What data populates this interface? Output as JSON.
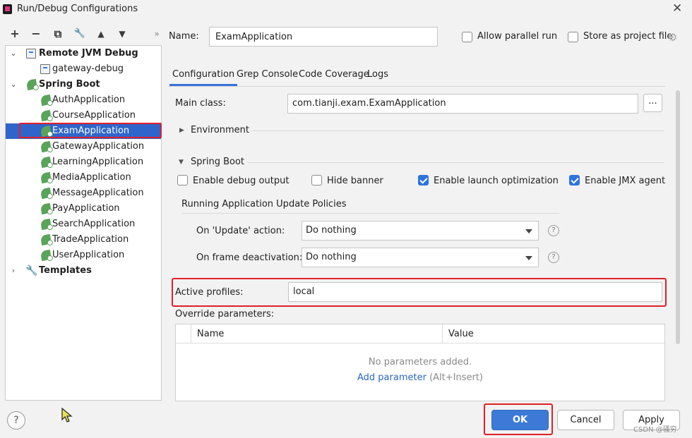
{
  "window": {
    "title": "Run/Debug Configurations"
  },
  "toolbar": {
    "icons": [
      "add-icon",
      "remove-icon",
      "copy-icon",
      "wrench-icon",
      "move-up-icon",
      "move-down-icon",
      "more-icon"
    ],
    "glyphs": {
      "add": "+",
      "remove": "−",
      "copy": "⧉",
      "wrench": "🔧",
      "up": "▲",
      "down": "▼",
      "more": "»"
    }
  },
  "tree": {
    "groups": [
      {
        "label": "Remote JVM Debug",
        "expanded": true,
        "children": [
          "gateway-debug"
        ]
      },
      {
        "label": "Spring Boot",
        "expanded": true,
        "children": [
          "AuthApplication",
          "CourseApplication",
          "ExamApplication",
          "GatewayApplication",
          "LearningApplication",
          "MediaApplication",
          "MessageApplication",
          "PayApplication",
          "SearchApplication",
          "TradeApplication",
          "UserApplication"
        ]
      },
      {
        "label": "Templates",
        "expanded": false,
        "children": []
      }
    ],
    "selected": "ExamApplication"
  },
  "header": {
    "name_label": "Name:",
    "name_value": "ExamApplication",
    "allow_parallel_label": "Allow parallel run",
    "allow_parallel_checked": false,
    "store_project_label": "Store as project file",
    "store_project_checked": false
  },
  "tabs": [
    "Configuration",
    "Grep Console",
    "Code Coverage",
    "Logs"
  ],
  "active_tab": "Configuration",
  "config": {
    "main_class_label": "Main class:",
    "main_class_value": "com.tianji.exam.ExamApplication",
    "browse_label": "...",
    "environment_label": "Environment",
    "spring_boot_label": "Spring Boot",
    "options": [
      {
        "label": "Enable debug output",
        "checked": false
      },
      {
        "label": "Hide banner",
        "checked": false
      },
      {
        "label": "Enable launch optimization",
        "checked": true
      },
      {
        "label": "Enable JMX agent",
        "checked": true
      }
    ],
    "policies_label": "Running Application Update Policies",
    "update_action_label": "On 'Update' action:",
    "update_action_value": "Do nothing",
    "frame_deactivation_label": "On frame deactivation:",
    "frame_deactivation_value": "Do nothing",
    "active_profiles_label": "Active profiles:",
    "active_profiles_value": "local",
    "override_label": "Override parameters:",
    "table_headers": [
      "Name",
      "Value"
    ],
    "empty_text": "No parameters added.",
    "add_param_link": "Add parameter",
    "add_param_shortcut": "(Alt+Insert)"
  },
  "buttons": {
    "ok": "OK",
    "cancel": "Cancel",
    "apply": "Apply"
  },
  "watermark": "CSDN @骚穷"
}
